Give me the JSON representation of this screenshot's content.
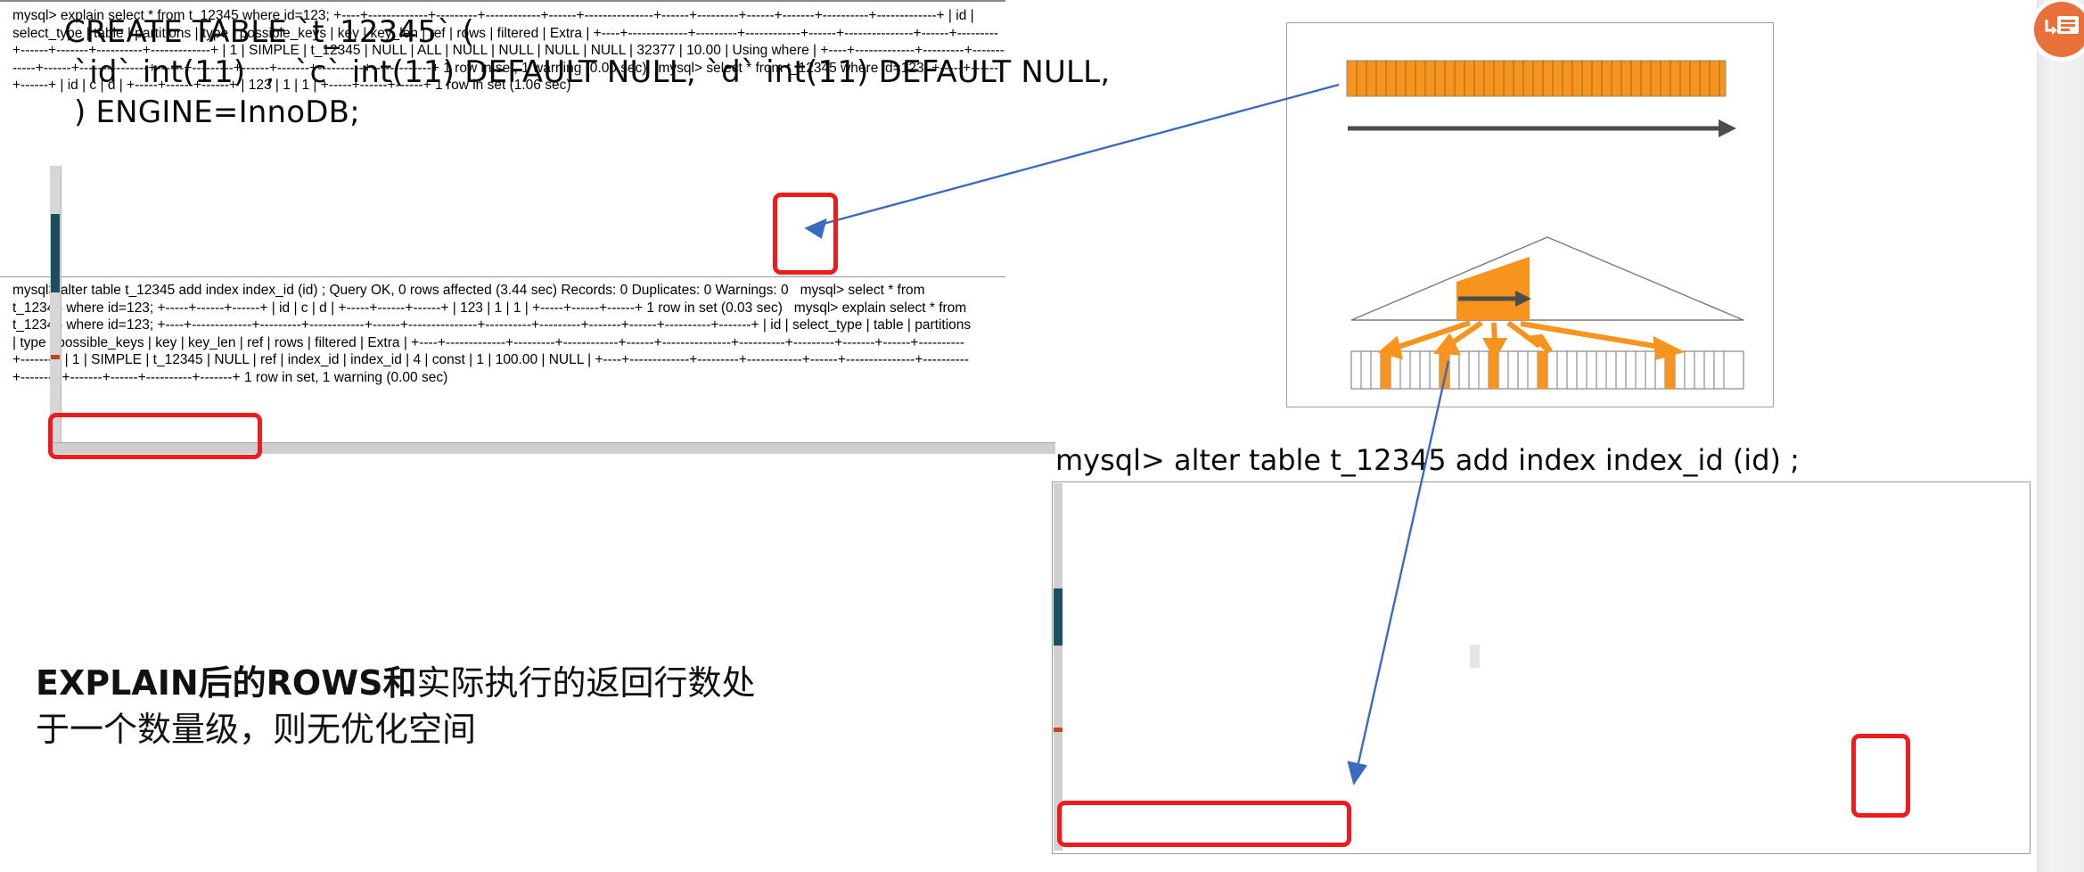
{
  "slide": {
    "create_table_sql": "CREATE TABLE `t_12345` (\n `id` int(11)  ,  `c` int(11) DEFAULT NULL, `d` int(11) DEFAULT NULL,\n ) ENGINE=InnoDB;",
    "alter_caption": "mysql> alter table t_12345 add index index_id (id) ;",
    "conclusion_bold": "EXPLAIN后的ROWS和",
    "conclusion_rest": "实际执行的返回行数处于一个数量级，则无优化空间"
  },
  "badge": {
    "icon": "powerpoint-icon",
    "color": "#e8703a"
  },
  "colors": {
    "accent_orange": "#f7941e",
    "annotation_red": "#ee1c1c",
    "connector_blue": "#3b6bbf",
    "terminal_bg": "#060606",
    "terminal_fg": "#d9d9d9"
  },
  "terminal_top": {
    "title": "mysql-terminal-before-index",
    "lines": [
      "mysql> explain select * from t_12345 where id=123;",
      "+----+-------------+---------+------------+------+---------------+------+---------+------+-------+----------+-------------+",
      "| id | select_type | table   | partitions | type | possible_keys | key  | key_len | ref  | rows  | filtered | Extra       |",
      "+----+-------------+---------+------------+------+---------------+------+---------+------+-------+----------+-------------+",
      "|  1 | SIMPLE      | t_12345 | NULL       | ALL  | NULL          | NULL | NULL    | NULL | 32377 |    10.00 | Using where |",
      "+----+-------------+---------+------------+------+---------------+------+---------+------+-------+----------+-------------+",
      "1 row in set, 1 warning (0.00 sec)",
      "",
      "mysql>  select * from t_12345 where id=123;",
      "+-----+------+------+",
      "| id  | c    | d    |",
      "+-----+------+------+",
      "| 123 |    1 |    1 |",
      "+-----+------+------+",
      "1 row in set (1.06 sec)"
    ],
    "explain_row": {
      "id": "1",
      "select_type": "SIMPLE",
      "table": "t_12345",
      "partitions": "NULL",
      "type": "ALL",
      "possible_keys": "NULL",
      "key": "NULL",
      "key_len": "NULL",
      "ref": "NULL",
      "rows": "32377",
      "filtered": "10.00",
      "extra": "Using where"
    },
    "result_row": {
      "id": "123",
      "c": "1",
      "d": "1"
    },
    "elapsed": "1 row in set (1.06 sec)"
  },
  "terminal_bottom": {
    "title": "mysql-terminal-after-index",
    "lines": [
      "mysql> alter table t_12345 add index index_id (id) ;",
      "Query OK, 0 rows affected (3.44 sec)",
      "Records: 0  Duplicates: 0  Warnings: 0",
      "",
      "mysql>  select * from t_12345 where id=123;",
      "+-----+------+------+",
      "| id  | c    | d    |",
      "+-----+------+------+",
      "| 123 |    1 |    1 |",
      "+-----+------+------+",
      "1 row in set (0.03 sec)",
      "",
      "mysql> explain select * from t_12345 where id=123;",
      "+----+-------------+---------+------------+------+---------------+----------+---------+-------+------+----------+-------+",
      "| id | select_type | table   | partitions | type | possible_keys | key      | key_len | ref   | rows | filtered | Extra |",
      "+----+-------------+---------+------------+------+---------------+----------+---------+-------+------+----------+-------+",
      "|  1 | SIMPLE      | t_12345 | NULL       | ref  | index_id      | index_id | 4       | const |    1 |   100.00 | NULL  |",
      "+----+-------------+---------+------------+------+---------------+----------+---------+-------+------+----------+-------+",
      "1 row in set, 1 warning (0.00 sec)"
    ],
    "alter_status": "Query OK, 0 rows affected (3.44 sec)",
    "alter_records": "Records: 0  Duplicates: 0  Warnings: 0",
    "explain_row": {
      "id": "1",
      "select_type": "SIMPLE",
      "table": "t_12345",
      "partitions": "NULL",
      "type": "ref",
      "possible_keys": "index_id",
      "key": "index_id",
      "key_len": "4",
      "ref": "const",
      "rows": "1",
      "filtered": "100.00",
      "extra": "NULL"
    },
    "result_row": {
      "id": "123",
      "c": "1",
      "d": "1"
    },
    "elapsed": "1 row in set (0.03 sec)",
    "explain_elapsed": "1 row in set, 1 warning (0.00 sec)"
  },
  "diagram": {
    "name": "full-scan-vs-index-scan-diagram",
    "top_strip_cells": 38,
    "tree_leaf_cells": 38,
    "tree_leaf_highlighted": [
      4,
      9,
      14,
      19,
      32
    ]
  },
  "annotations": [
    {
      "name": "red-box-rows-top",
      "target": "rows column 32377"
    },
    {
      "name": "red-box-result-top",
      "target": "1 row in set (1.06 sec)"
    },
    {
      "name": "red-box-rows-bottom",
      "target": "rows column 1"
    },
    {
      "name": "red-box-result-bottom",
      "target": "1 row in set, 1 warning (0.00 sec)"
    }
  ]
}
